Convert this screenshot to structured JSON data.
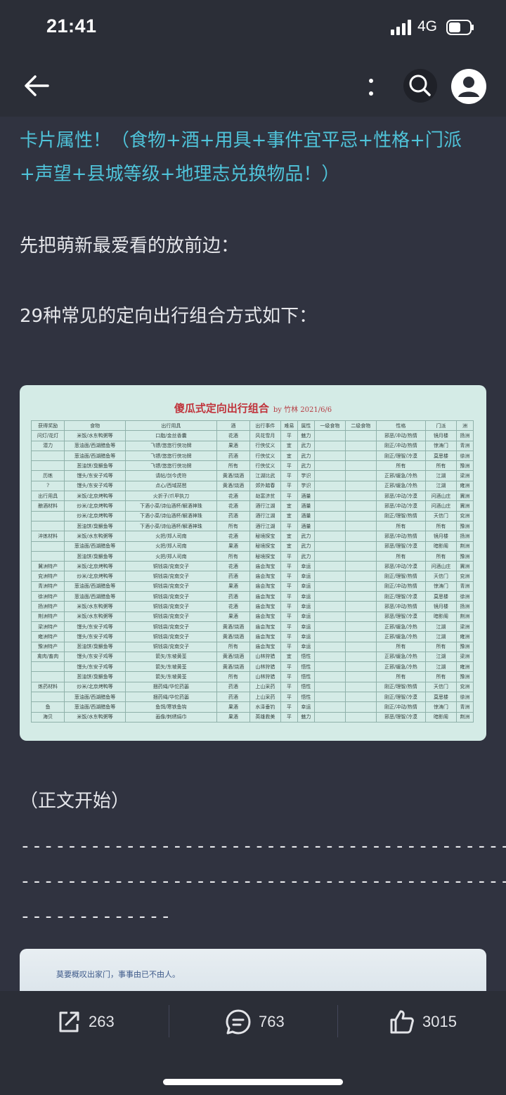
{
  "status_bar": {
    "time": "21:41",
    "network": "4G"
  },
  "nav": {
    "back_icon": "back-arrow-icon",
    "more_icon": "more-vertical-icon",
    "search_icon": "search-icon",
    "avatar_icon": "user-avatar-icon"
  },
  "article": {
    "highlight_line1": "卡片属性！（食物+酒+用具+事件宜平忌+性格+门派",
    "highlight_line2": "+声望+县城等级+地理志兑换物品！）",
    "intro": "先把萌新最爱看的放前边：",
    "combos_title": "29种常见的定向出行组合方式如下：",
    "main_start": "（正文开始）",
    "dash_line1": "------------------------------------------------------------------------",
    "dash_line2": "------------------------------------------------------------------------",
    "dash_line3": "-------------"
  },
  "table_image": {
    "title": "傻瓜式定向出行组合",
    "byline": "by 竹林 2021/6/6",
    "headers": [
      "获得奖励",
      "食物",
      "出行用具",
      "酒",
      "出行事件",
      "难易",
      "属性",
      "一级食物",
      "二级食物",
      "性格",
      "门派",
      "洲"
    ],
    "rows": [
      [
        "问灯/花灯",
        "米饭/水东鸭粥等",
        "口脂/金丝香囊",
        "花酒",
        "风花雪月",
        "平",
        "魅力",
        "",
        "",
        "邪恶/冲动/热情",
        "镜月楼",
        "扬洲"
      ],
      [
        "潜力",
        "葱油面/西湖醋鱼等",
        "飞镖/悠悠行侠功牌",
        "果酒",
        "行侠仗义",
        "宜",
        "武力",
        "",
        "",
        "刚正/冲动/热情",
        "惊涛门",
        "青洲"
      ],
      [
        "",
        "葱油面/西湖醋鱼等",
        "飞镖/悠悠行侠功牌",
        "药酒",
        "行侠仗义",
        "宜",
        "武力",
        "",
        "",
        "刚正/理智/冷漠",
        "莫思楼",
        "徐洲"
      ],
      [
        "",
        "葱油饼/臭鳜鱼等",
        "飞镖/悠悠行侠功牌",
        "所有",
        "行侠仗义",
        "平",
        "武力",
        "",
        "",
        "所有",
        "所有",
        "豫洲"
      ],
      [
        "历练",
        "馒头/东安子鸡等",
        "请帖/剑今虎符",
        "黄酒/烧酒",
        "江湖比武",
        "平",
        "学识",
        "",
        "",
        "正邪/缓急/冷热",
        "江湖",
        "梁洲"
      ],
      [
        "?",
        "馒头/东安子鸡等",
        "点心/西域琵琶",
        "黄酒/烧酒",
        "郊外踏春",
        "平",
        "学识",
        "",
        "",
        "正邪/缓急/冷热",
        "江湖",
        "雍洲"
      ],
      [
        "出行用具",
        "米饭/北京烤鸭等",
        "火折子/爪甲执刀",
        "花酒",
        "劫富济贫",
        "平",
        "酒量",
        "",
        "",
        "邪恶/冲动/冷漠",
        "问酒山庄",
        "冀洲"
      ],
      [
        "酿酒材料",
        "炒米/北京烤鸭等",
        "下酒小菜/诗仙酒杯/解酒神珠",
        "花酒",
        "酒行江湖",
        "宜",
        "酒量",
        "",
        "",
        "邪恶/冲动/冷漠",
        "问酒山庄",
        "冀洲"
      ],
      [
        "",
        "炒米/北京烤鸭等",
        "下酒小菜/诗仙酒杯/解酒神珠",
        "药酒",
        "酒行江湖",
        "宜",
        "酒量",
        "",
        "",
        "刚正/理智/热情",
        "天信门",
        "兖洲"
      ],
      [
        "",
        "葱油饼/臭鳜鱼等",
        "下酒小菜/诗仙酒杯/解酒神珠",
        "所有",
        "酒行江湖",
        "平",
        "酒量",
        "",
        "",
        "所有",
        "所有",
        "豫洲"
      ],
      [
        "淬炼材料",
        "米饭/水东鸭粥等",
        "火把/郑人司南",
        "花酒",
        "秘境探宝",
        "宜",
        "武力",
        "",
        "",
        "邪恶/冲动/热情",
        "镜月楼",
        "扬洲"
      ],
      [
        "",
        "葱油面/西湖醋鱼等",
        "火把/郑人司南",
        "果酒",
        "秘境探宝",
        "宜",
        "武力",
        "",
        "",
        "邪恶/理智/冷漠",
        "暗影阁",
        "荆洲"
      ],
      [
        "",
        "葱油饼/臭鳜鱼等",
        "火把/郑人司南",
        "所有",
        "秘境探宝",
        "平",
        "武力",
        "",
        "",
        "所有",
        "所有",
        "豫洲"
      ],
      [
        "冀洲特产",
        "米饭/北京烤鸭等",
        "铜钱袋/兖南交子",
        "花酒",
        "庙会淘宝",
        "平",
        "幸运",
        "",
        "",
        "邪恶/冲动/冷漠",
        "问酒山庄",
        "冀洲"
      ],
      [
        "兖洲特产",
        "炒米/北京烤鸭等",
        "铜钱袋/兖南交子",
        "药酒",
        "庙会淘宝",
        "平",
        "幸运",
        "",
        "",
        "刚正/理智/热情",
        "天信门",
        "兖洲"
      ],
      [
        "青洲特产",
        "葱油面/西湖醋鱼等",
        "铜钱袋/兖南交子",
        "果酒",
        "庙会淘宝",
        "平",
        "幸运",
        "",
        "",
        "刚正/冲动/热情",
        "惊涛门",
        "青洲"
      ],
      [
        "徐洲特产",
        "葱油面/西湖醋鱼等",
        "铜钱袋/兖南交子",
        "药酒",
        "庙会淘宝",
        "平",
        "幸运",
        "",
        "",
        "刚正/理智/冷漠",
        "莫思楼",
        "徐洲"
      ],
      [
        "扬洲特产",
        "米饭/水东鸭粥等",
        "铜钱袋/兖南交子",
        "花酒",
        "庙会淘宝",
        "平",
        "幸运",
        "",
        "",
        "邪恶/冲动/热情",
        "镜月楼",
        "扬洲"
      ],
      [
        "荆洲特产",
        "米饭/水东鸭粥等",
        "铜钱袋/兖南交子",
        "果酒",
        "庙会淘宝",
        "平",
        "幸运",
        "",
        "",
        "邪恶/理智/冷漠",
        "暗影阁",
        "荆洲"
      ],
      [
        "梁洲特产",
        "馒头/东安子鸡等",
        "铜钱袋/兖南交子",
        "黄酒/烧酒",
        "庙会淘宝",
        "平",
        "幸运",
        "",
        "",
        "正邪/缓急/冷热",
        "江湖",
        "梁洲"
      ],
      [
        "雍洲特产",
        "馒头/东安子鸡等",
        "铜钱袋/兖南交子",
        "黄酒/烧酒",
        "庙会淘宝",
        "平",
        "幸运",
        "",
        "",
        "正邪/缓急/冷热",
        "江湖",
        "雍洲"
      ],
      [
        "豫洲特产",
        "葱油饼/臭鳜鱼等",
        "铜钱袋/兖南交子",
        "所有",
        "庙会淘宝",
        "平",
        "幸运",
        "",
        "",
        "所有",
        "所有",
        "豫洲"
      ],
      [
        "禽肉/畜肉",
        "馒头/东安子鸡等",
        "箭矢/东坡黄荃",
        "黄酒/烧酒",
        "山林狩猎",
        "宜",
        "悟性",
        "",
        "",
        "正邪/缓急/冷热",
        "江湖",
        "梁洲"
      ],
      [
        "",
        "馒头/东安子鸡等",
        "箭矢/东坡黄荃",
        "黄酒/烧酒",
        "山林狩猎",
        "平",
        "悟性",
        "",
        "",
        "正邪/缓急/冷热",
        "江湖",
        "雍洲"
      ],
      [
        "",
        "葱油饼/臭鳜鱼等",
        "箭矢/东坡黄荃",
        "所有",
        "山林狩猎",
        "平",
        "悟性",
        "",
        "",
        "所有",
        "所有",
        "豫洲"
      ],
      [
        "炼药材料",
        "炒米/北京烤鸭等",
        "捆药绳/华佗药篓",
        "药酒",
        "上山采药",
        "平",
        "悟性",
        "",
        "",
        "刚正/理智/热情",
        "天信门",
        "兖洲"
      ],
      [
        "",
        "葱油面/西湖醋鱼等",
        "捆药绳/华佗药篓",
        "药酒",
        "上山采药",
        "平",
        "悟性",
        "",
        "",
        "刚正/理智/冷漠",
        "莫思楼",
        "徐洲"
      ],
      [
        "鱼",
        "葱油面/西湖醋鱼等",
        "鱼饵/寒铁鱼钩",
        "果酒",
        "水泽垂钓",
        "平",
        "幸运",
        "",
        "",
        "刚正/冲动/热情",
        "惊涛门",
        "青洲"
      ],
      [
        "海贝",
        "米饭/水东鸭粥等",
        "画像/刺绣绢巾",
        "果酒",
        "英雄救美",
        "平",
        "魅力",
        "",
        "",
        "邪恶/理智/冷漠",
        "暗影阁",
        "荆洲"
      ]
    ]
  },
  "next_image": {
    "caption": "莫要概叹出家门，事事由已不由人。"
  },
  "bottom_bar": {
    "share_count": "263",
    "share_icon": "share-icon",
    "comment_count": "763",
    "comment_icon": "comment-icon",
    "like_count": "3015",
    "like_icon": "thumbs-up-icon"
  }
}
